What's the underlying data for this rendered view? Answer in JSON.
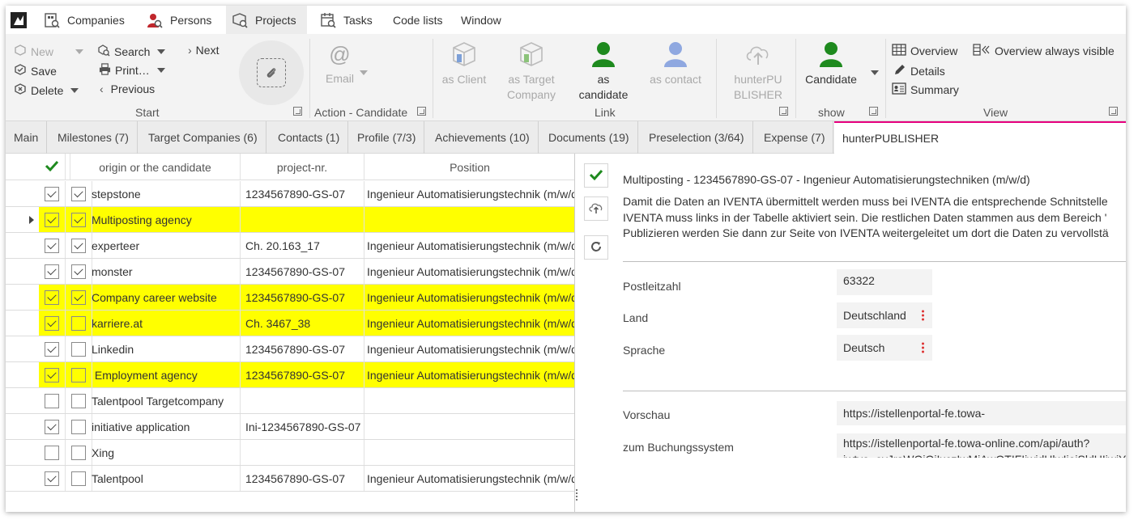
{
  "menubar": {
    "items": [
      {
        "label": "Companies",
        "icon": "companies-icon"
      },
      {
        "label": "Persons",
        "icon": "persons-icon"
      },
      {
        "label": "Projects",
        "icon": "projects-icon"
      },
      {
        "label": "Tasks",
        "icon": "tasks-icon"
      },
      {
        "label": "Code lists"
      },
      {
        "label": "Window"
      }
    ]
  },
  "ribbon": {
    "start": {
      "new": "New",
      "save": "Save",
      "delete": "Delete",
      "search": "Search",
      "print": "Print…",
      "next": "Next",
      "previous": "Previous",
      "group_label": "Start"
    },
    "action": {
      "email": "Email",
      "group_label": "Action - Candidate"
    },
    "link": {
      "as_client": "as Client",
      "as_target": "as Target\nCompany",
      "as_candidate": "as\ncandidate",
      "as_contact": "as contact",
      "group_label": "Link"
    },
    "publisher": {
      "label": "hunterPU\nBLISHER"
    },
    "show": {
      "candidate": "Candidate",
      "group_label": "show"
    },
    "view": {
      "overview": "Overview",
      "details": "Details",
      "summary": "Summary",
      "overview_always": "Overview always visible",
      "group_label": "View"
    },
    "colors": {
      "green": "#1e8a1e",
      "blue_person": "#8fa8e0",
      "grey_icon": "#b5b5b5"
    }
  },
  "tabs": [
    "Main",
    "Milestones (7)",
    "Target Companies (6)",
    "Contacts (1)",
    "Profile (7/3)",
    "Achievements (10)",
    "Documents (19)",
    "Preselection (3/64)",
    "Expense (7)",
    "hunterPUBLISHER"
  ],
  "grid": {
    "columns": [
      "origin or the candidate",
      "project-nr.",
      "Position"
    ],
    "rows": [
      {
        "c1": true,
        "c2": true,
        "origin": "stepstone",
        "nr": "1234567890-GS-07",
        "position": "Ingenieur Automatisierungstechnik (m/w/d)",
        "hl": false,
        "current": false
      },
      {
        "c1": true,
        "c2": true,
        "origin": "Multiposting agency",
        "nr": "",
        "position": "",
        "hl": true,
        "current": true
      },
      {
        "c1": true,
        "c2": true,
        "origin": "experteer",
        "nr": "Ch. 20.163_17",
        "position": "Ingenieur Automatisierungstechnik (m/w/d)",
        "hl": false,
        "current": false
      },
      {
        "c1": true,
        "c2": true,
        "origin": "monster",
        "nr": "1234567890-GS-07",
        "position": "Ingenieur Automatisierungstechnik (m/w/d)",
        "hl": false,
        "current": false
      },
      {
        "c1": true,
        "c2": true,
        "origin": "Company career website",
        "nr": "1234567890-GS-07",
        "position": "Ingenieur Automatisierungstechnik (m/w/d)",
        "hl": true,
        "current": false
      },
      {
        "c1": true,
        "c2": false,
        "origin": "karriere.at",
        "nr": "Ch. 3467_38",
        "position": "Ingenieur Automatisierungstechnik (m/w/d)",
        "hl": true,
        "current": false
      },
      {
        "c1": true,
        "c2": false,
        "origin": "Linkedin",
        "nr": "1234567890-GS-07",
        "position": "Ingenieur Automatisierungstechnik (m/w/d)",
        "hl": false,
        "current": false
      },
      {
        "c1": true,
        "c2": false,
        "origin": " Employment agency",
        "nr": "1234567890-GS-07",
        "position": "Ingenieur Automatisierungstechnik (m/w/d)",
        "hl": true,
        "current": false
      },
      {
        "c1": false,
        "c2": false,
        "origin": "Talentpool Targetcompany",
        "nr": "",
        "position": "",
        "hl": false,
        "current": false
      },
      {
        "c1": true,
        "c2": false,
        "origin": "initiative application",
        "nr": "Ini-1234567890-GS-07",
        "position": "",
        "hl": false,
        "current": false
      },
      {
        "c1": false,
        "c2": false,
        "origin": "Xing",
        "nr": "",
        "position": "",
        "hl": false,
        "current": false
      },
      {
        "c1": true,
        "c2": false,
        "origin": "Talentpool",
        "nr": "1234567890-GS-07",
        "position": "Ingenieur Automatisierungstechnik (m/w/d)",
        "hl": false,
        "current": false
      }
    ],
    "highlight_color": "#ffff00"
  },
  "panel": {
    "title": "Multiposting - 1234567890-GS-07 - Ingenieur Automatisierungstechniken (m/w/d)",
    "text_lines": [
      "Damit die Daten an IVENTA übermittelt werden muss bei IVENTA die entsprechende Schnitstelle",
      "IVENTA muss links in der Tabelle aktiviert sein. Die restlichen Daten stammen aus dem Bereich '",
      "Publizieren werden Sie dann zur Seite von IVENTA weitergeleitet um dort die Daten zu vervollstä"
    ],
    "fields": [
      {
        "label": "Postleitzahl",
        "value": "63322"
      },
      {
        "label": "Land",
        "value": "Deutschland"
      },
      {
        "label": "Sprache",
        "value": "Deutsch"
      }
    ],
    "links": [
      {
        "label": "Vorschau",
        "value": "https://istellenportal-fe.towa-"
      },
      {
        "label": "zum Buchungssystem",
        "value": "https://istellenportal-fe.towa-online.com/api/auth?",
        "value2": "jwtvo=eyJraWQiOiIxczIwMiAwOTIFIiwidHlwIjoiSldUIiwiYW"
      }
    ]
  }
}
